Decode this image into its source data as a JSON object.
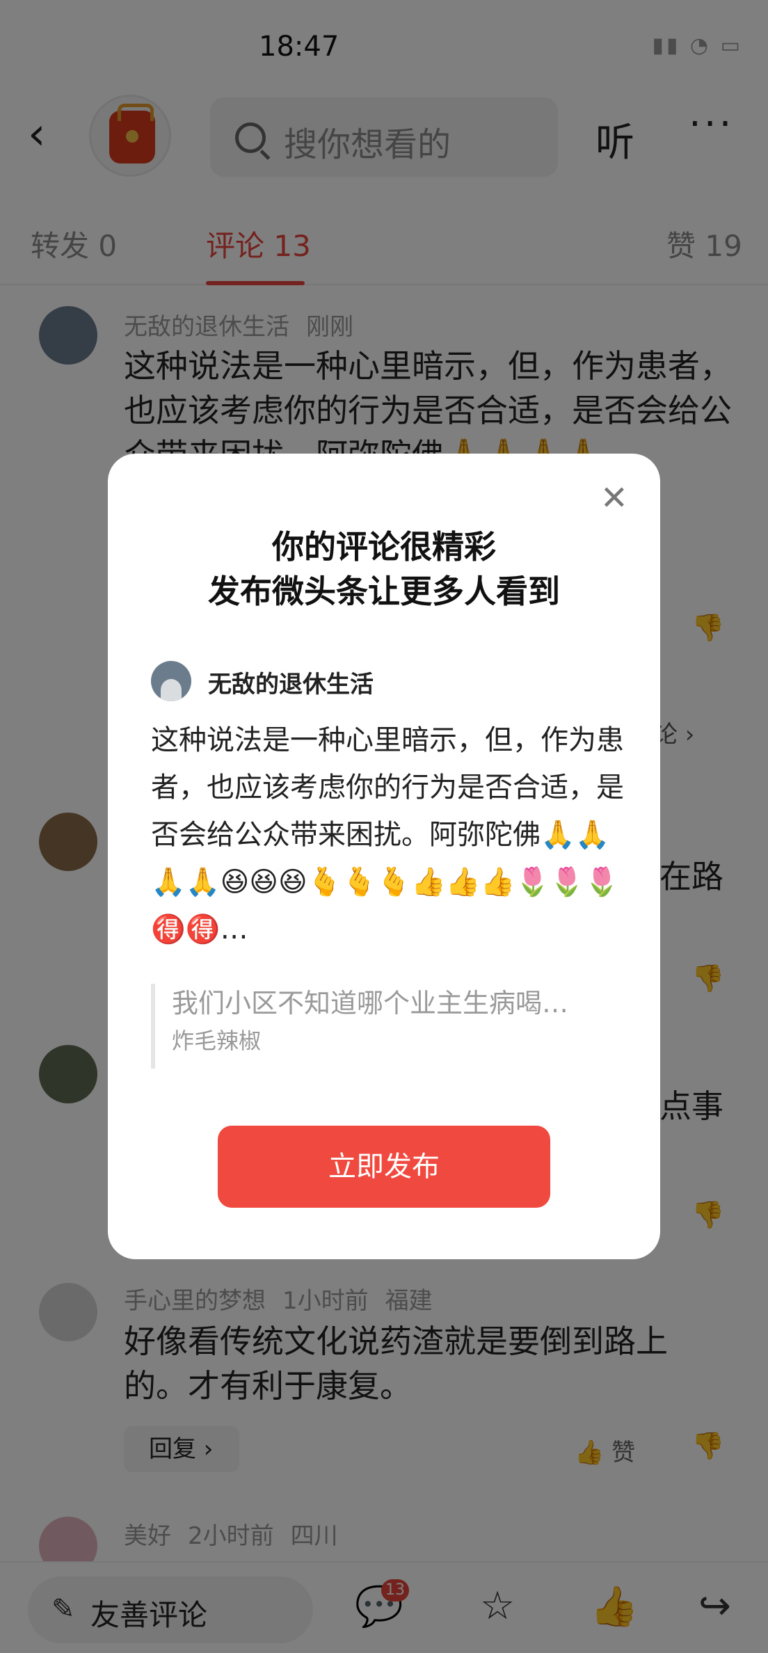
{
  "status_bar": {
    "time": "18:47"
  },
  "header": {
    "back_icon": "back-arrow-icon",
    "search_placeholder": "搜你想看的",
    "listen_label": "听",
    "more_icon": "more-dots-icon"
  },
  "tabs": [
    {
      "label": "转发 0",
      "active": false
    },
    {
      "label": "评论 13",
      "active": true
    },
    {
      "label": "赞 19",
      "active": false
    }
  ],
  "comments": [
    {
      "user": "无敌的退休生活",
      "time": "刚刚",
      "location": "",
      "text": "这种说法是一种心里暗示，但，作为患者，也应该考虑你的行为是否合适，是否会给公众带来困扰。阿弥陀佛🙏🙏🙏🙏"
    },
    {
      "user": "",
      "time": "",
      "location": "",
      "text": "在路"
    },
    {
      "user": "",
      "time": "",
      "location": "",
      "text": "点事"
    },
    {
      "user": "手心里的梦想",
      "time": "1小时前",
      "location": "福建",
      "text": "好像看传统文化说药渣就是要倒到路上的。才有利于康复。"
    },
    {
      "user": "美好",
      "time": "2小时前",
      "location": "四川",
      "text": ""
    }
  ],
  "comment_actions": {
    "reply_label": "回复",
    "like_label": "赞"
  },
  "hidden_reply_hint": "论",
  "bottom_bar": {
    "input_placeholder": "友善评论",
    "comment_count": "13",
    "icons": [
      "comment-icon",
      "star-icon",
      "thumbs-up-icon",
      "share-icon"
    ]
  },
  "modal": {
    "title_line1": "你的评论很精彩",
    "title_line2": "发布微头条让更多人看到",
    "username": "无敌的退休生活",
    "text": "这种说法是一种心里暗示，但，作为患者，也应该考虑你的行为是否合适，是否会给公众带来困扰。阿弥陀佛🙏🙏🙏🙏😆😆😆🫰🫰🫰👍👍👍🌷🌷🌷🉐🉐…",
    "quote_text": "我们小区不知道哪个业主生病喝…",
    "quote_author": "炸毛辣椒",
    "publish_label": "立即发布"
  },
  "colors": {
    "accent": "#e8453c",
    "publish_button": "#f04a40",
    "overlay": "rgba(0,0,0,0.5)"
  }
}
